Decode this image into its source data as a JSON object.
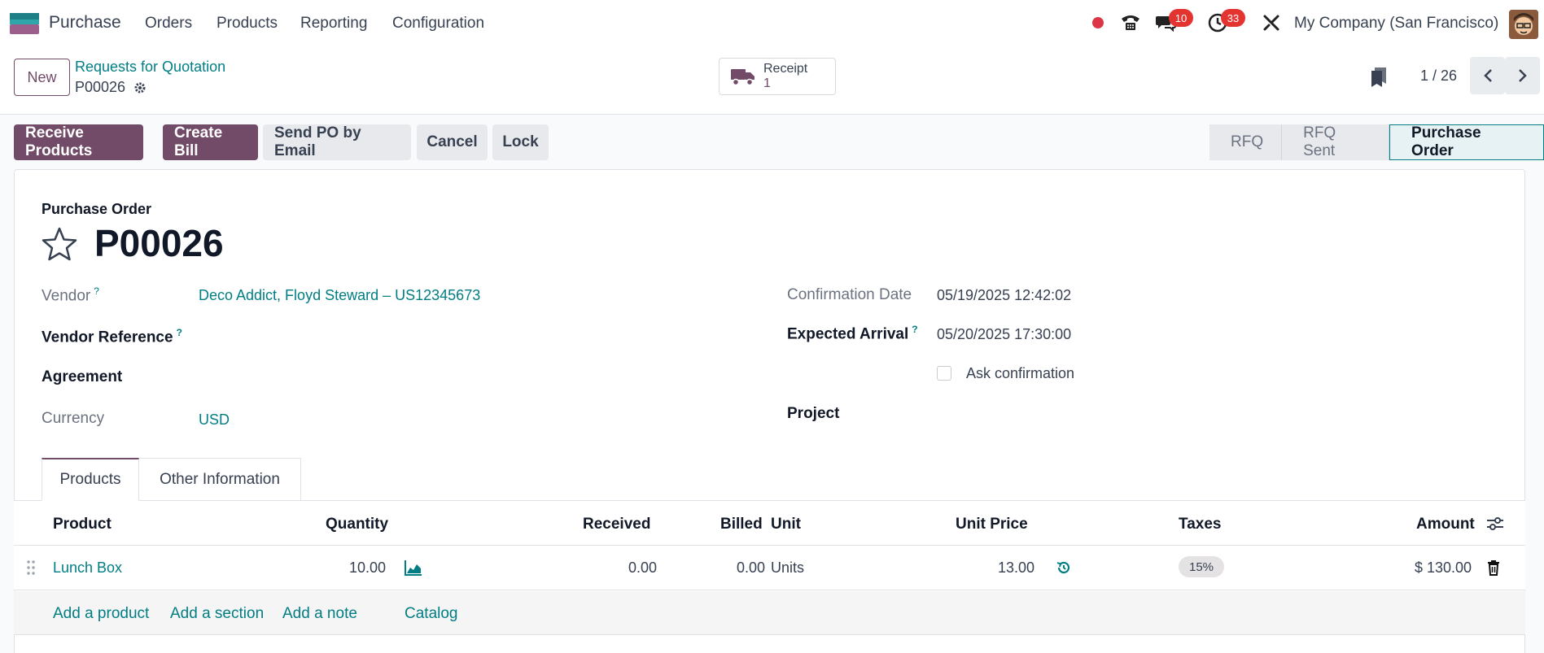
{
  "navbar": {
    "app_name": "Purchase",
    "menu": [
      "Orders",
      "Products",
      "Reporting",
      "Configuration"
    ],
    "messages_count": "10",
    "activities_count": "33",
    "company": "My Company (San Francisco)"
  },
  "control": {
    "new_label": "New",
    "breadcrumb": "Requests for Quotation",
    "record": "P00026",
    "receipt_label": "Receipt",
    "receipt_count": "1",
    "pager": "1 / 26"
  },
  "actions": {
    "receive": "Receive Products",
    "bill": "Create Bill",
    "send": "Send PO by Email",
    "cancel": "Cancel",
    "lock": "Lock"
  },
  "status": {
    "stages": [
      "RFQ",
      "RFQ Sent",
      "Purchase Order"
    ],
    "active": "Purchase Order"
  },
  "form": {
    "subtitle": "Purchase Order",
    "title": "P00026",
    "vendor_label": "Vendor",
    "vendor": "Deco Addict, Floyd Steward – US12345673",
    "vendor_ref_label": "Vendor Reference",
    "agreement_label": "Agreement",
    "currency_label": "Currency",
    "currency": "USD",
    "confirmation_label": "Confirmation Date",
    "confirmation": "05/19/2025 12:42:02",
    "arrival_label": "Expected Arrival",
    "arrival": "05/20/2025 17:30:00",
    "ask_label": "Ask confirmation",
    "project_label": "Project",
    "help_mark": "?"
  },
  "tabs": [
    "Products",
    "Other Information"
  ],
  "table": {
    "headers": [
      "Product",
      "Quantity",
      "Received",
      "Billed",
      "Unit",
      "Unit Price",
      "Taxes",
      "Amount"
    ],
    "rows": [
      {
        "product": "Lunch Box",
        "quantity": "10.00",
        "received": "0.00",
        "billed": "0.00",
        "unit": "Units",
        "price": "13.00",
        "tax": "15%",
        "amount": "$ 130.00"
      }
    ],
    "add_product": "Add a product",
    "add_section": "Add a section",
    "add_note": "Add a note",
    "catalog": "Catalog"
  },
  "colors": {
    "brand": "#714b67",
    "link": "#017e84",
    "badge": "#e3342f"
  }
}
